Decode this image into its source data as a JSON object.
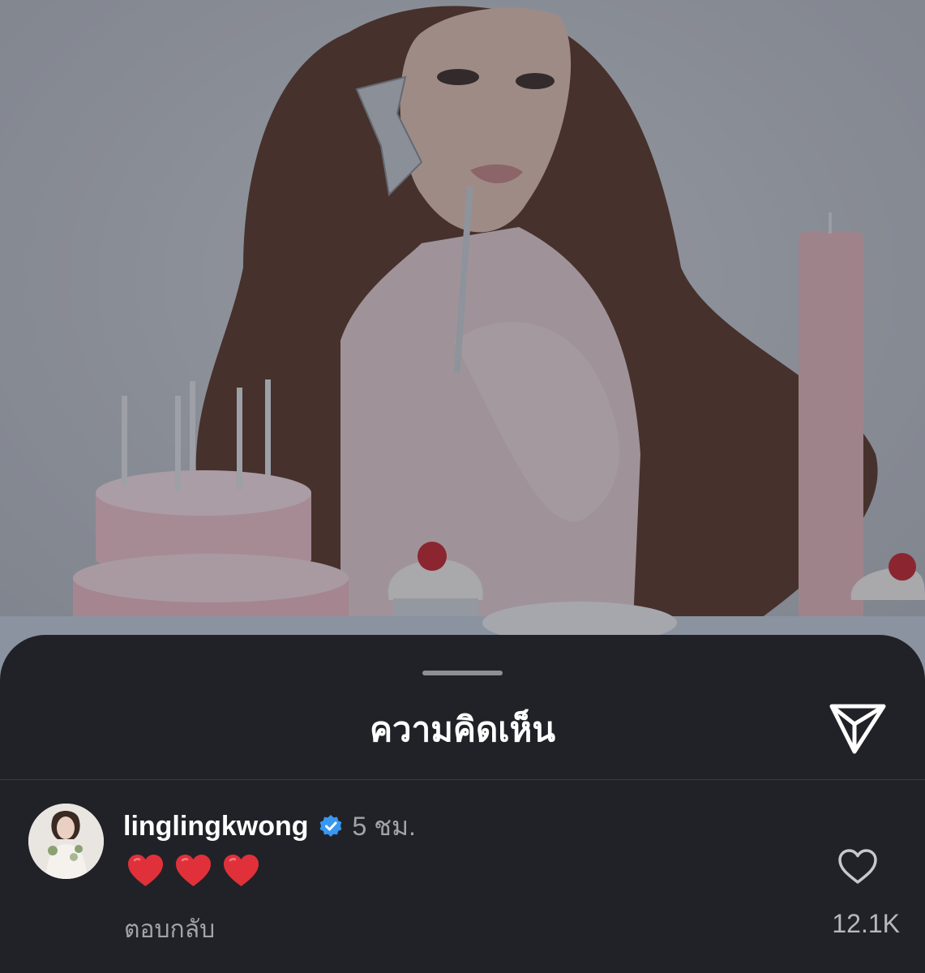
{
  "sheet": {
    "title": "ความคิดเห็น",
    "share_icon": "paper-plane-icon"
  },
  "comment": {
    "username": "linglingkwong",
    "verified_icon": "verified-badge-icon",
    "time": "5 ชม.",
    "text": "❤️❤️❤️",
    "reply_label": "ตอบกลับ",
    "like_icon": "heart-outline-icon",
    "like_count": "12.1K"
  },
  "colors": {
    "sheet_background": "#212227",
    "verified_blue": "#3897f0",
    "heart_red": "#e0313a",
    "secondary_text": "#a3a3a8"
  }
}
